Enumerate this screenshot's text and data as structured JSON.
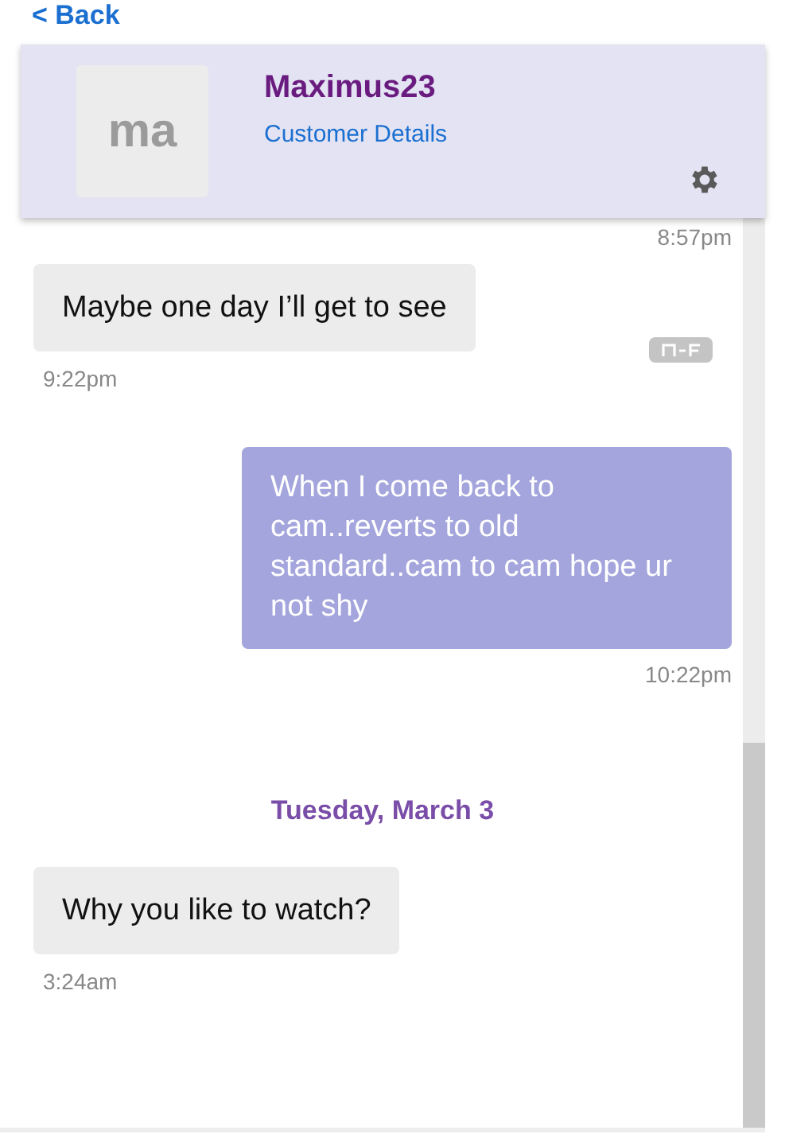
{
  "back_link": "< Back",
  "header": {
    "avatar": "ma",
    "name": "Maximus23",
    "details_link": "Customer Details"
  },
  "messages": [
    {
      "kind": "time",
      "time": "8:57pm"
    },
    {
      "kind": "received",
      "text": "Maybe one day I’ll get to see",
      "time": "9:22pm",
      "flagged": true
    },
    {
      "kind": "sent",
      "text": "When I come back to cam..reverts to old standard..cam to cam hope ur not shy",
      "time": "10:22pm",
      "flagged": false
    },
    {
      "kind": "date",
      "text": "Tuesday, March 3"
    },
    {
      "kind": "received",
      "text": "Why you like to watch?",
      "time": "3:24am",
      "flagged": false
    }
  ]
}
